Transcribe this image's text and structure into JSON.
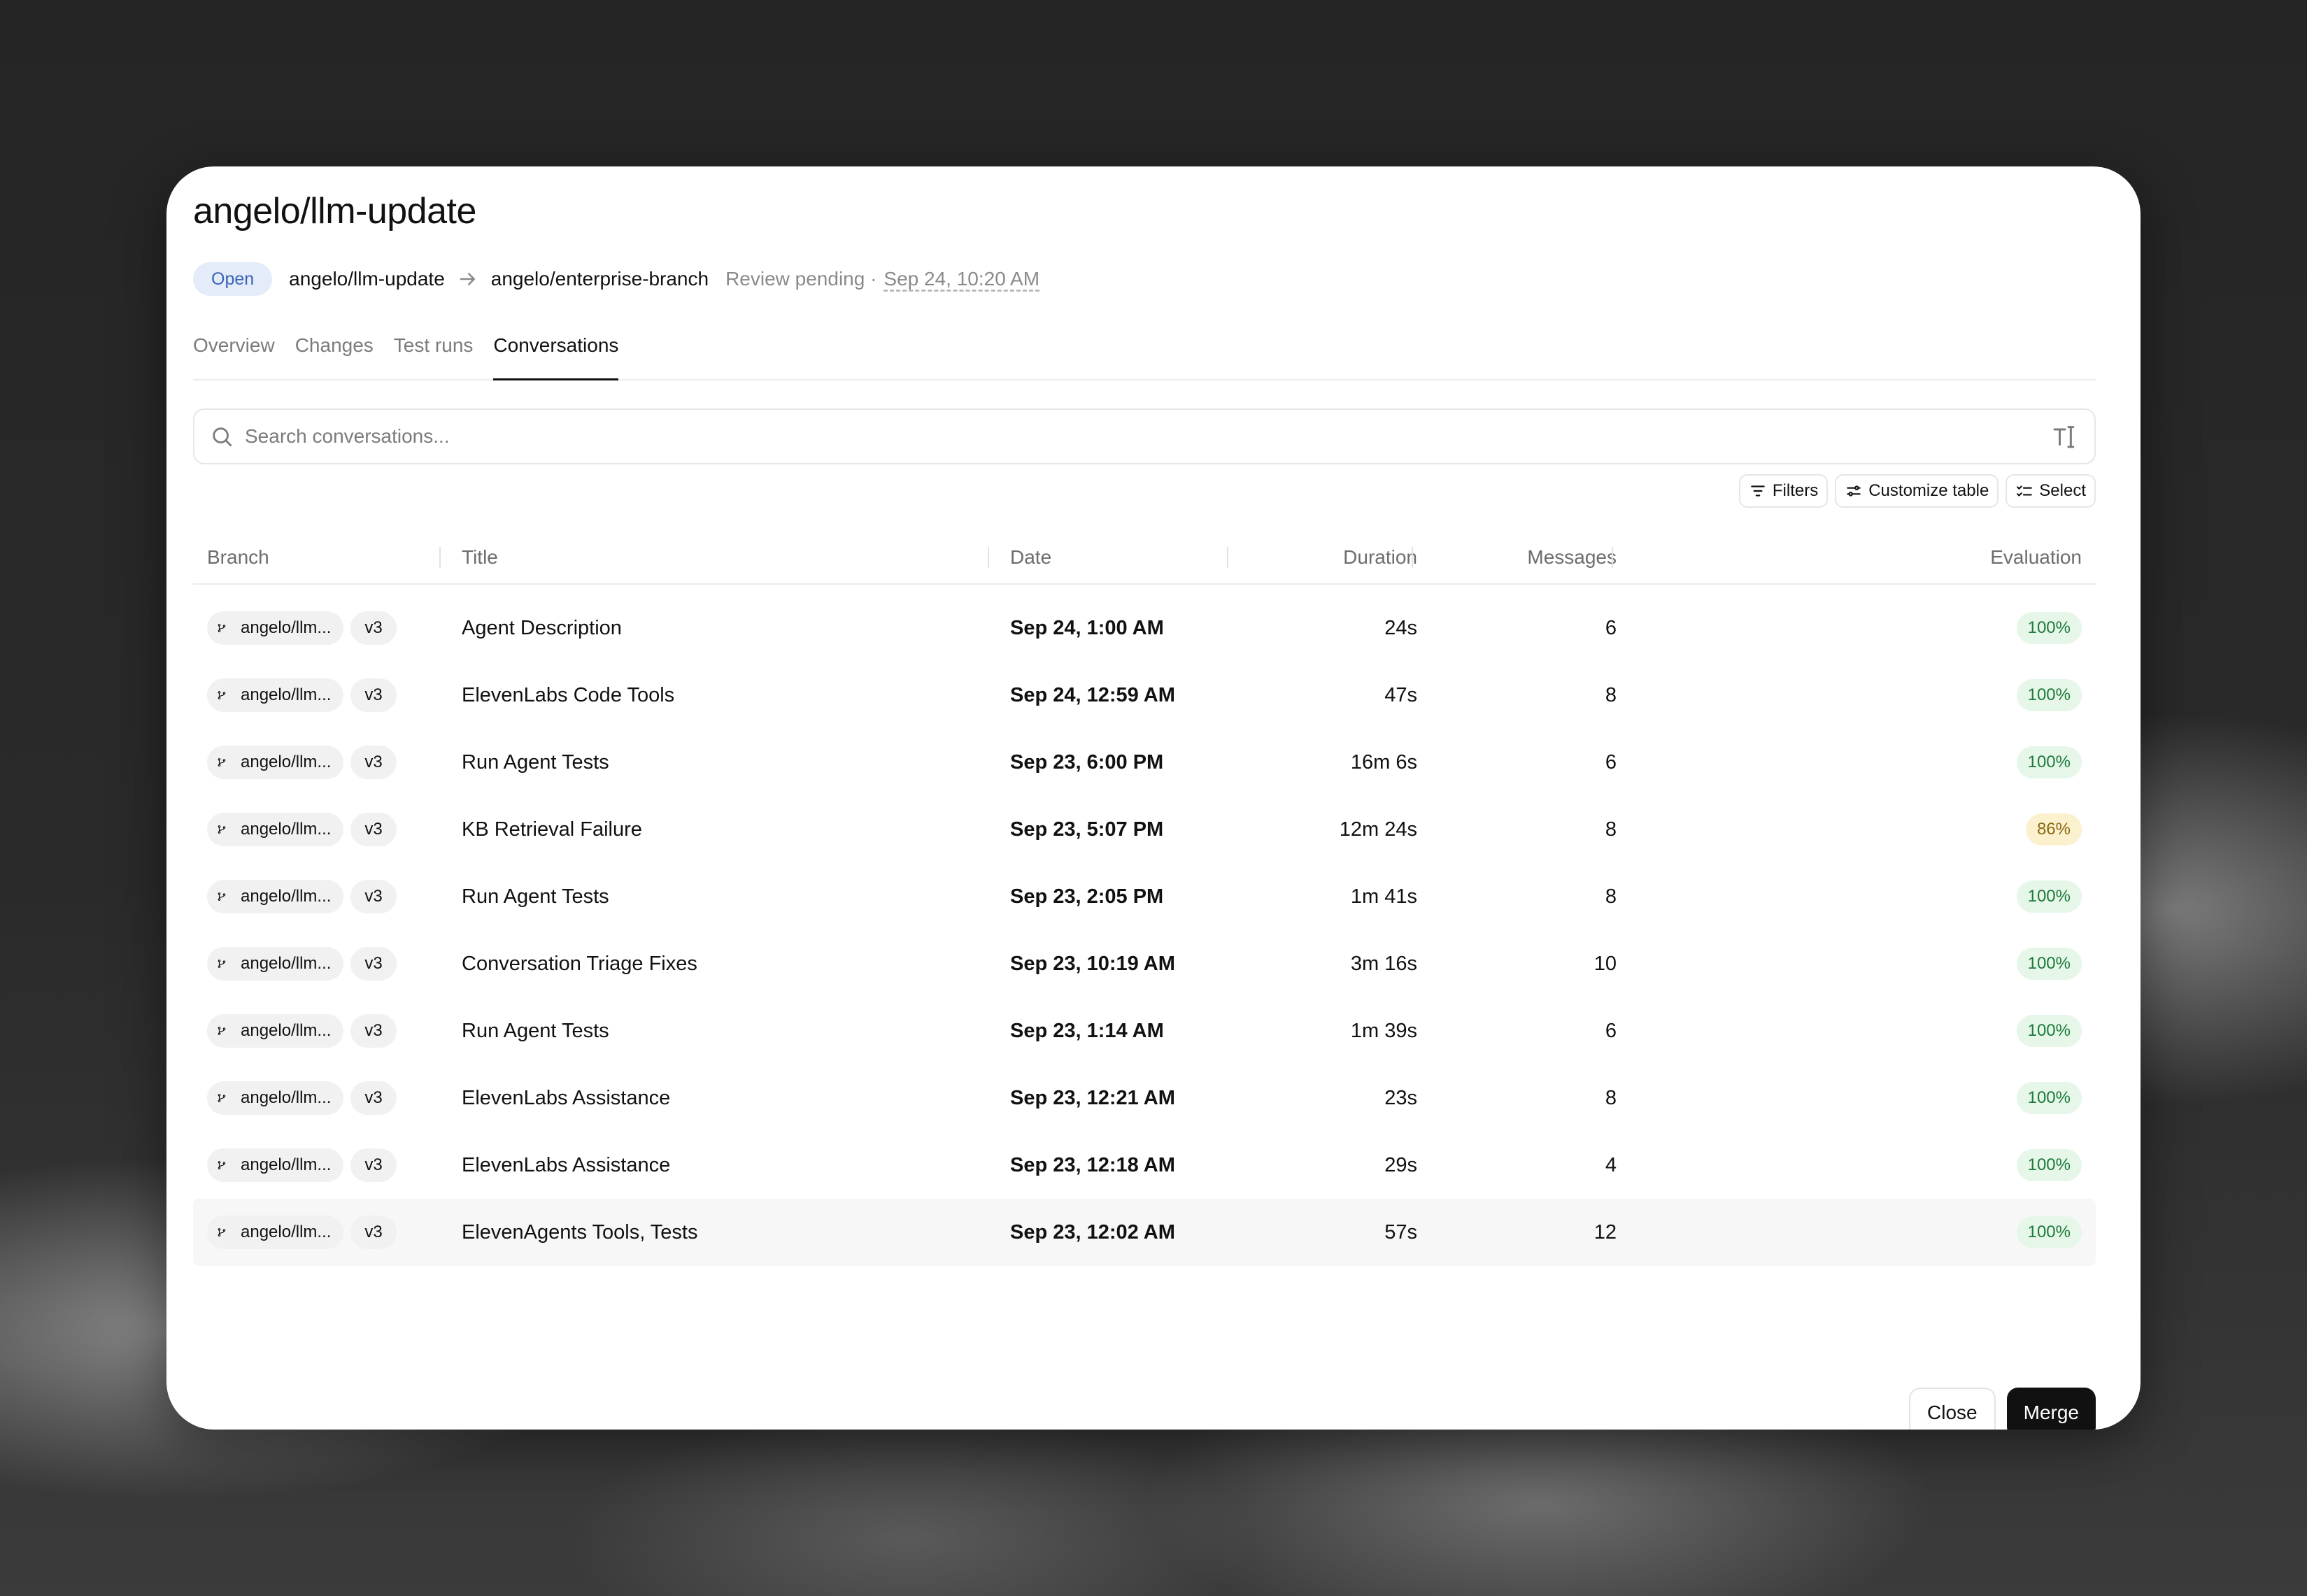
{
  "header": {
    "title": "angelo/llm-update",
    "status_badge": "Open",
    "from_branch": "angelo/llm-update",
    "to_branch": "angelo/enterprise-branch",
    "review_status": "Review pending ·",
    "review_date": "Sep 24, 10:20 AM"
  },
  "tabs": [
    {
      "label": "Overview",
      "active": false
    },
    {
      "label": "Changes",
      "active": false
    },
    {
      "label": "Test runs",
      "active": false
    },
    {
      "label": "Conversations",
      "active": true
    }
  ],
  "search": {
    "placeholder": "Search conversations..."
  },
  "toolbar": {
    "filters": "Filters",
    "customize": "Customize table",
    "select": "Select"
  },
  "table": {
    "columns": {
      "branch": "Branch",
      "title": "Title",
      "date": "Date",
      "duration": "Duration",
      "messages": "Messages",
      "evaluation": "Evaluation"
    },
    "rows": [
      {
        "branch": "angelo/llm...",
        "version": "v3",
        "title": "Agent Description",
        "date": "Sep 24, 1:00 AM",
        "duration": "24s",
        "messages": "6",
        "evaluation": "100%"
      },
      {
        "branch": "angelo/llm...",
        "version": "v3",
        "title": "ElevenLabs Code Tools",
        "date": "Sep 24, 12:59 AM",
        "duration": "47s",
        "messages": "8",
        "evaluation": "100%"
      },
      {
        "branch": "angelo/llm...",
        "version": "v3",
        "title": "Run Agent Tests",
        "date": "Sep 23, 6:00 PM",
        "duration": "16m 6s",
        "messages": "6",
        "evaluation": "100%"
      },
      {
        "branch": "angelo/llm...",
        "version": "v3",
        "title": "KB Retrieval Failure",
        "date": "Sep 23, 5:07 PM",
        "duration": "12m 24s",
        "messages": "8",
        "evaluation": "86%"
      },
      {
        "branch": "angelo/llm...",
        "version": "v3",
        "title": "Run Agent Tests",
        "date": "Sep 23, 2:05 PM",
        "duration": "1m 41s",
        "messages": "8",
        "evaluation": "100%"
      },
      {
        "branch": "angelo/llm...",
        "version": "v3",
        "title": "Conversation Triage Fixes",
        "date": "Sep 23, 10:19 AM",
        "duration": "3m 16s",
        "messages": "10",
        "evaluation": "100%"
      },
      {
        "branch": "angelo/llm...",
        "version": "v3",
        "title": "Run Agent Tests",
        "date": "Sep 23, 1:14 AM",
        "duration": "1m 39s",
        "messages": "6",
        "evaluation": "100%"
      },
      {
        "branch": "angelo/llm...",
        "version": "v3",
        "title": "ElevenLabs Assistance",
        "date": "Sep 23, 12:21 AM",
        "duration": "23s",
        "messages": "8",
        "evaluation": "100%"
      },
      {
        "branch": "angelo/llm...",
        "version": "v3",
        "title": "ElevenLabs Assistance",
        "date": "Sep 23, 12:18 AM",
        "duration": "29s",
        "messages": "4",
        "evaluation": "100%"
      },
      {
        "branch": "angelo/llm...",
        "version": "v3",
        "title": "ElevenAgents Tools, Tests",
        "date": "Sep 23, 12:02 AM",
        "duration": "57s",
        "messages": "12",
        "evaluation": "100%"
      }
    ]
  },
  "footer": {
    "close": "Close",
    "merge": "Merge"
  },
  "colors": {
    "eval_good_bg": "#e6f7ea",
    "eval_warn_bg": "#fcf1cf",
    "open_badge_bg": "#e4ecf9",
    "primary_button": "#111111"
  }
}
